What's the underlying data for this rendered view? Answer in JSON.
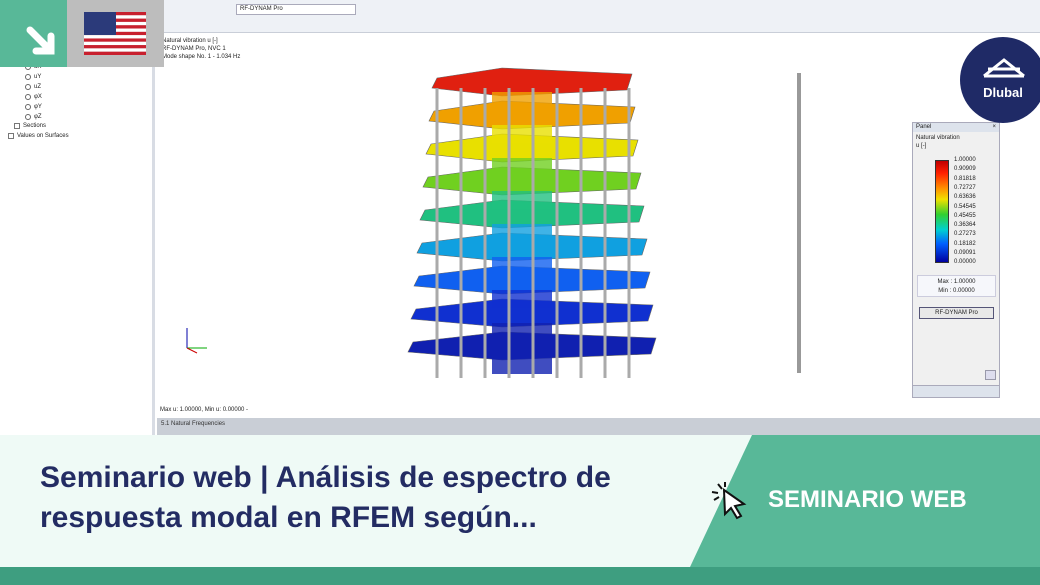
{
  "toolbar": {
    "module_select": "RF-DYNAM Pro"
  },
  "tree": {
    "items": [
      "uX",
      "uY",
      "uZ",
      "φX",
      "φY",
      "φZ"
    ],
    "sections": "Sections",
    "values_on_surfaces": "Values on Surfaces"
  },
  "viewport": {
    "info_lines": [
      "Natural vibration u [-]",
      "RF-DYNAM Pro, NVC 1",
      "Mode shape No. 1 - 1.034 Hz"
    ],
    "max_min": "Max u: 1.00000, Min u: 0.00000 -"
  },
  "panel": {
    "title": "Panel",
    "label": "Natural vibration",
    "unit": "u [-]",
    "scale": [
      "1.00000",
      "0.90909",
      "0.81818",
      "0.72727",
      "0.63636",
      "0.54545",
      "0.45455",
      "0.36364",
      "0.27273",
      "0.18182",
      "0.09091",
      "0.00000"
    ],
    "max_label": "Max :",
    "max": "1.00000",
    "min_label": "Min :",
    "min": "0.00000",
    "button": "RF-DYNAM Pro"
  },
  "bottom_panel": {
    "title": "5.1 Natural Frequencies"
  },
  "banner": {
    "title": "Seminario web | Análisis de espectro de respuesta modal en RFEM según...",
    "tag": "SEMINARIO WEB",
    "logo": "Dlubal"
  },
  "colors": {
    "green": "#58b898",
    "navy": "#232c63"
  }
}
